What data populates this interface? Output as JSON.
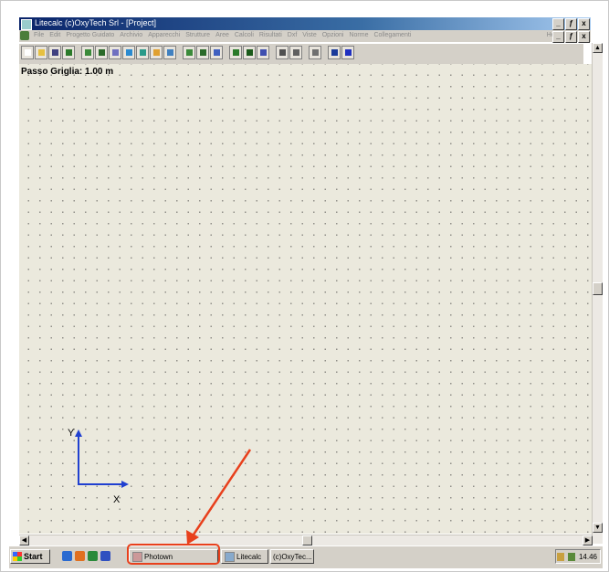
{
  "window": {
    "title": "Litecalc       (c)OxyTech Srl - [Project]",
    "controls": [
      "_",
      "ƒ",
      "x"
    ]
  },
  "menu": {
    "items": [
      "File",
      "Edit",
      "Progetto Guidato",
      "Archivio",
      "Apparecchi",
      "Strutture",
      "Aree",
      "Calcoli",
      "Risultati",
      "Dxf",
      "Viste",
      "Opzioni",
      "Norme",
      "Collegamenti"
    ],
    "help": "Help"
  },
  "canvas": {
    "grid_label": "Passo Griglia: 1.00 m",
    "axis_y_label": "Y",
    "axis_x_label": "X",
    "background_color": "#ebe9dd",
    "axis_color": "#2040d0"
  },
  "taskbar": {
    "start_label": "Start",
    "tasks": [
      {
        "label": "Photown"
      },
      {
        "label": "Litecalc"
      },
      {
        "label": "(c)OxyTec..."
      }
    ],
    "clock": "14.46"
  },
  "annotation": {
    "color": "#e8401c"
  }
}
